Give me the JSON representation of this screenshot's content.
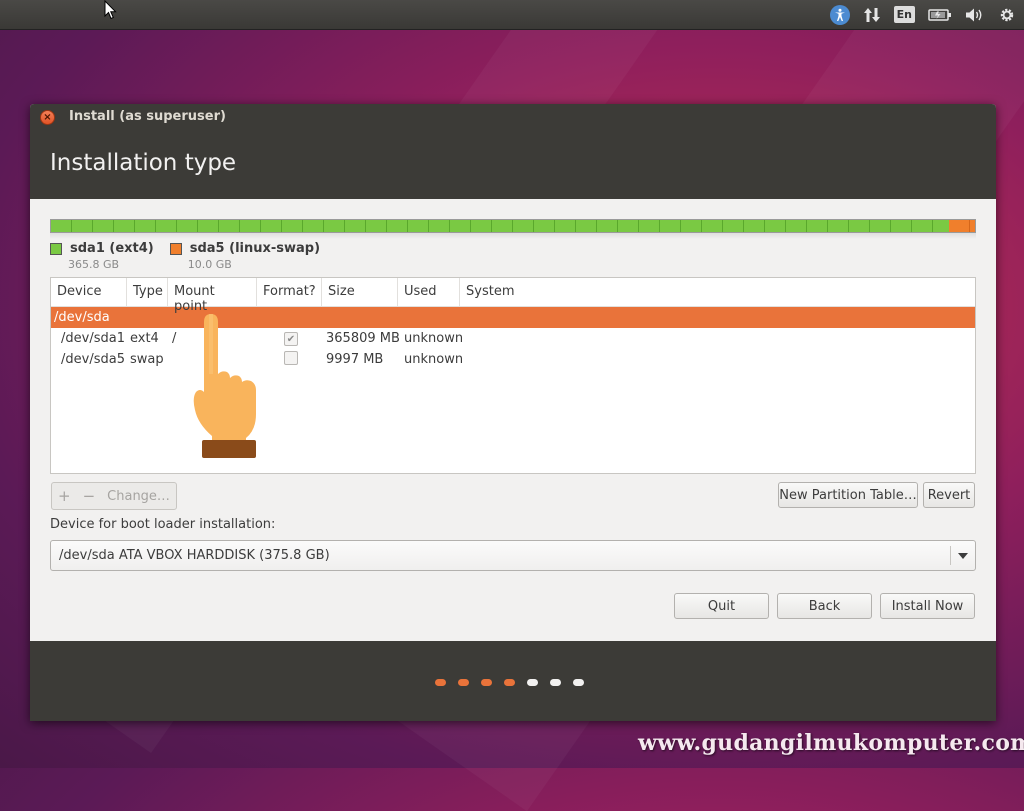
{
  "top_panel": {
    "keyboard_layout": "En",
    "icons": [
      "accessibility-icon",
      "network-icon",
      "keyboard-icon",
      "battery-icon",
      "volume-icon",
      "gear-icon"
    ]
  },
  "window": {
    "title": "Install (as superuser)",
    "close_glyph": "×",
    "page_title": "Installation type"
  },
  "partition_bar": {
    "segments": [
      {
        "name": "sda1 (ext4)",
        "size": "365.8 GB",
        "color": "#7ac943",
        "fraction": 0.9734
      },
      {
        "name": "sda5 (linux-swap)",
        "size": "10.0 GB",
        "color": "#f07f2c",
        "fraction": 0.0266
      }
    ]
  },
  "table": {
    "columns": [
      "Device",
      "Type",
      "Mount point",
      "Format?",
      "Size",
      "Used",
      "System"
    ],
    "disk_row": "/dev/sda",
    "rows": [
      {
        "device": "/dev/sda1",
        "type": "ext4",
        "mount": "/",
        "format": true,
        "size": "365809 MB",
        "used": "unknown",
        "system": ""
      },
      {
        "device": "/dev/sda5",
        "type": "swap",
        "mount": "",
        "format": false,
        "size": "9997 MB",
        "used": "unknown",
        "system": ""
      }
    ]
  },
  "partition_toolbar": {
    "add": "+",
    "remove": "−",
    "change": "Change…",
    "new_partition_table": "New Partition Table…",
    "revert": "Revert"
  },
  "bootloader": {
    "label": "Device for boot loader installation:",
    "selected": "/dev/sda   ATA VBOX HARDDISK (375.8 GB)"
  },
  "buttons": {
    "quit": "Quit",
    "back": "Back",
    "install_now": "Install Now"
  },
  "progress": {
    "completed_steps": 4,
    "total_steps": 7,
    "done_color": "#e9733a",
    "todo_color": "#f2f1f0"
  },
  "watermark": "www.gudangilmukomputer.com"
}
